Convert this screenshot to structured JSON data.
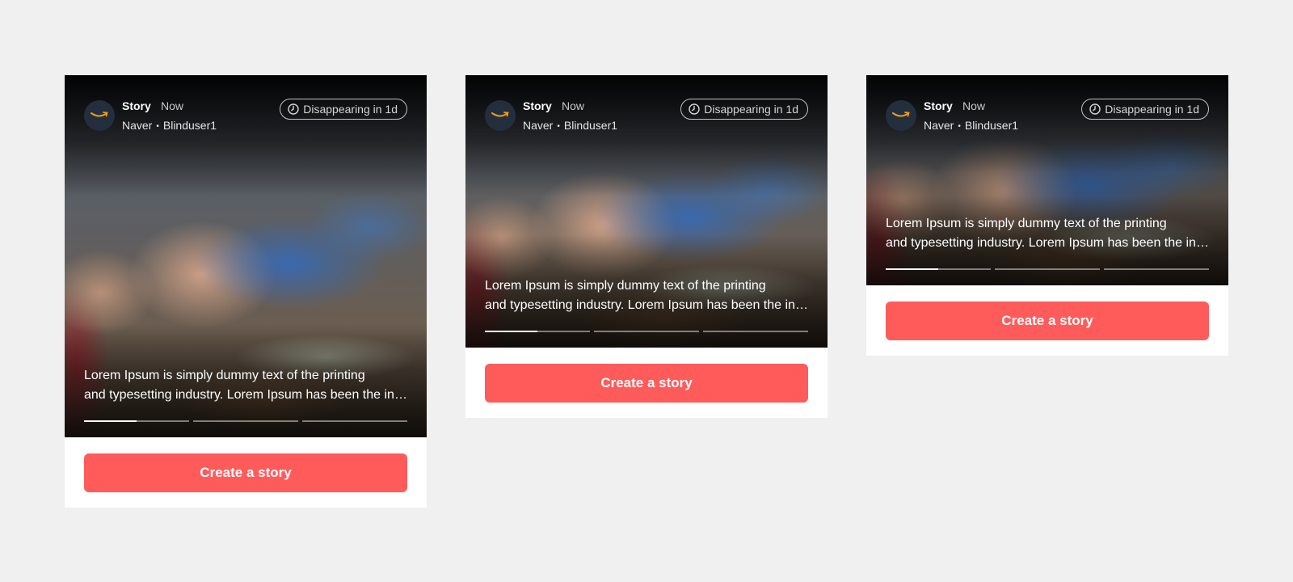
{
  "colors": {
    "page_background": "#f0f0f0",
    "card_background": "#ffffff",
    "cta_background": "#ff5b5b",
    "avatar_background": "#232f3e",
    "logo_smile": "#f39c12"
  },
  "icons": {
    "avatar": "amazon-logo",
    "timer": "clock-icon"
  },
  "cards": [
    {
      "title": "Story",
      "time": "Now",
      "source": "Naver",
      "author": "Blinduser1",
      "badge": "Disappearing in 1d",
      "caption_line1": "Lorem Ipsum is simply dummy text of the printing",
      "caption_line2": "and typesetting industry. Lorem Ipsum has been the industry's standard dummy text",
      "progress": [
        0.5,
        0,
        0
      ],
      "cta": "Create a story"
    },
    {
      "title": "Story",
      "time": "Now",
      "source": "Naver",
      "author": "Blinduser1",
      "badge": "Disappearing in 1d",
      "caption_line1": "Lorem Ipsum is simply dummy text of the printing",
      "caption_line2": "and typesetting industry. Lorem Ipsum has been the industry's standard dummy text",
      "progress": [
        0.5,
        0,
        0
      ],
      "cta": "Create a story"
    },
    {
      "title": "Story",
      "time": "Now",
      "source": "Naver",
      "author": "Blinduser1",
      "badge": "Disappearing in 1d",
      "caption_line1": "Lorem Ipsum is simply dummy text of the printing",
      "caption_line2": "and typesetting industry. Lorem Ipsum has been the industry's standard dummy text",
      "progress": [
        0.5,
        0,
        0
      ],
      "cta": "Create a story"
    }
  ]
}
